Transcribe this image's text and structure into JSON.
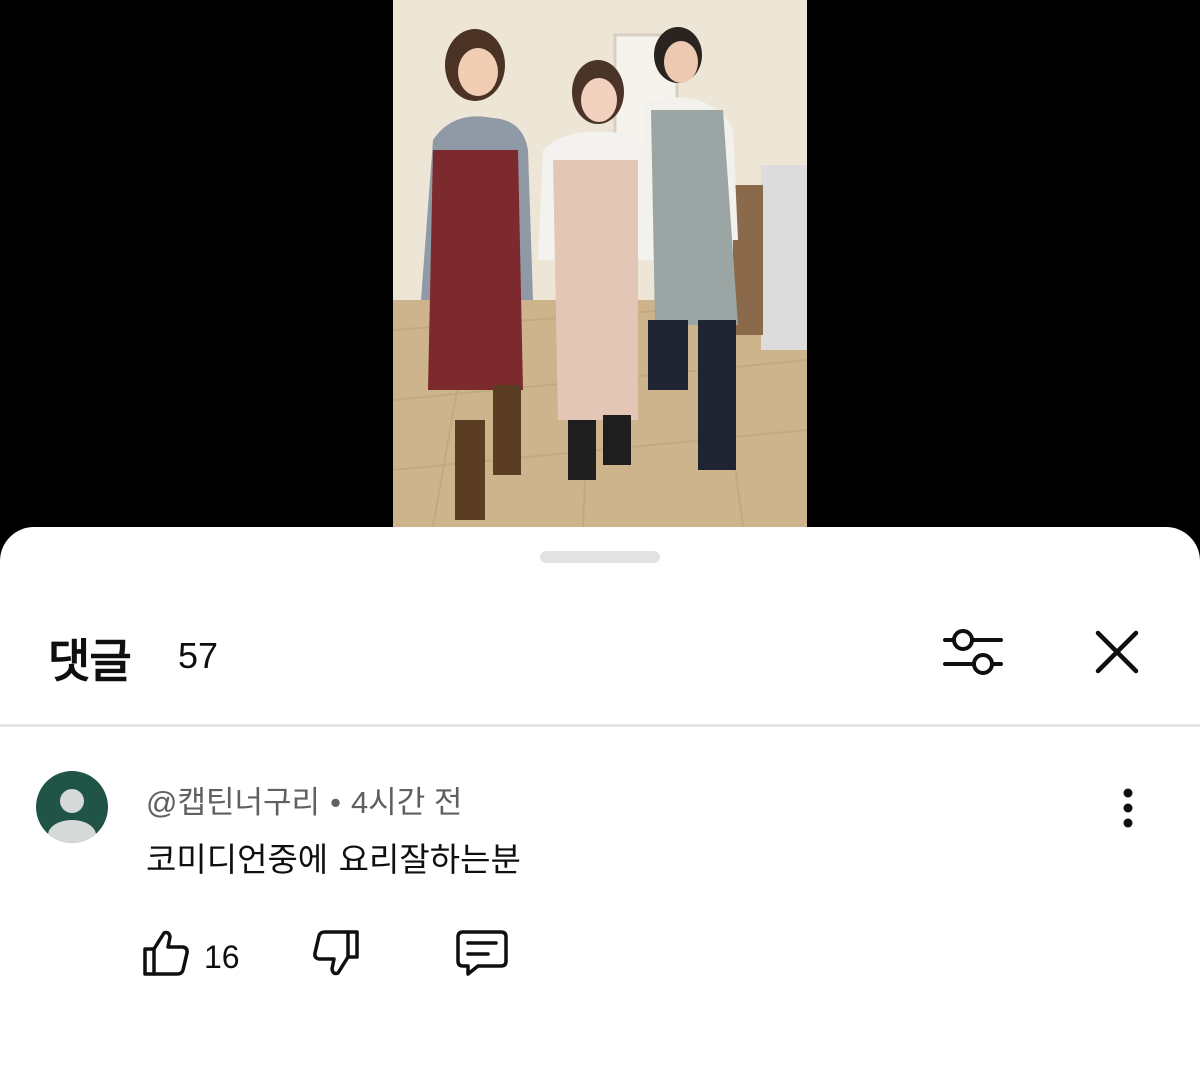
{
  "comments_panel": {
    "title": "댓글",
    "count": "57"
  },
  "comment": {
    "author": "@캡틴너구리",
    "separator": "•",
    "time": "4시간 전",
    "text": "코미디언중에 요리잘하는분",
    "like_count": "16"
  },
  "icons": {
    "filter": "sliders-icon",
    "close": "close-icon",
    "more": "more-vertical-icon",
    "like": "thumbs-up-icon",
    "dislike": "thumbs-down-icon",
    "reply": "comment-icon",
    "avatar": "default-avatar-icon"
  },
  "colors": {
    "avatar_bg": "#1f5446",
    "meta_text": "#606060",
    "handle": "#e3e3e3",
    "video_letterbox": "#000000"
  }
}
